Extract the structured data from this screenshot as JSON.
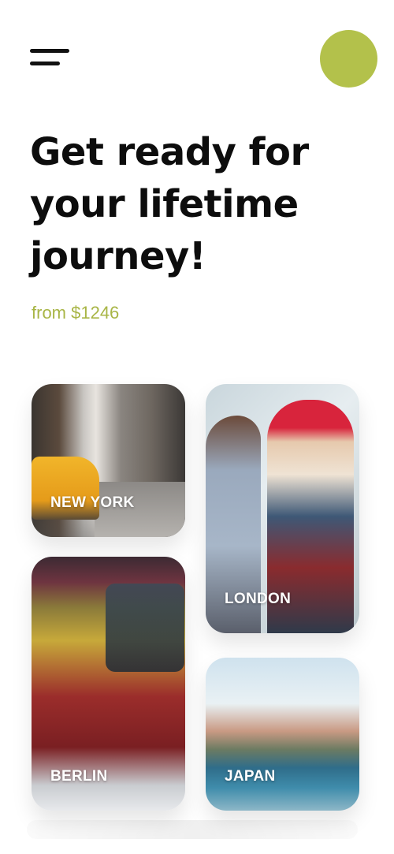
{
  "header": {
    "menu_icon": "hamburger-menu-icon",
    "avatar_color": "#b3c14b"
  },
  "hero": {
    "title_line1": "Get ready for",
    "title_line2": "your lifetime",
    "title_line3": "journey!",
    "price_text": "from $1246",
    "price_color": "#a8b545"
  },
  "destinations": [
    {
      "label": "NEW YORK"
    },
    {
      "label": "LONDON"
    },
    {
      "label": "BERLIN"
    },
    {
      "label": "JAPAN"
    }
  ]
}
